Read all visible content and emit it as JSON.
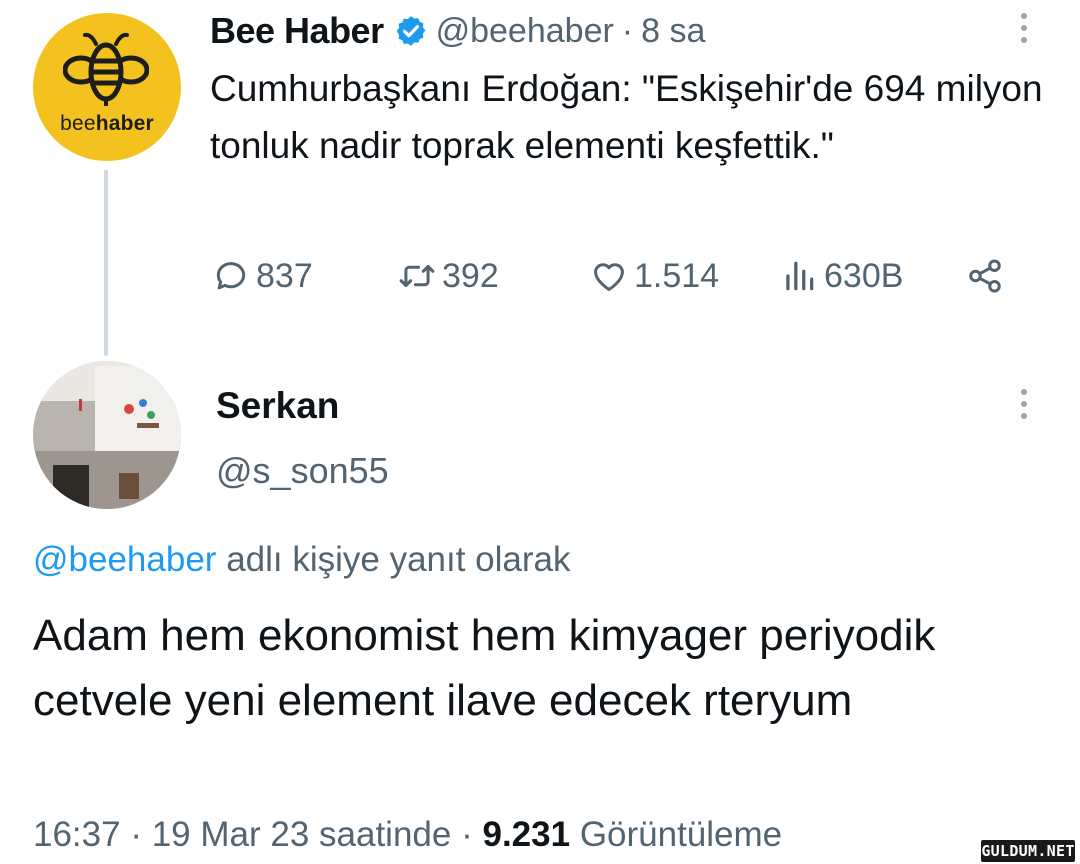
{
  "tweet": {
    "author": {
      "name": "Bee Haber",
      "handle": "@beehaber",
      "verified": true,
      "avatar_icon": "bee-logo-icon",
      "avatar_brand_color": "#f4c21e",
      "avatar_wordmark": {
        "prefix": "bee",
        "suffix": "haber"
      }
    },
    "separator": "·",
    "time": "8 sa",
    "text": "Cumhurbaşkanı Erdoğan: \"Eskişehir'de 694 milyon tonluk nadir toprak elementi keşfettik.\"",
    "actions": {
      "replies": "837",
      "retweets": "392",
      "likes": "1.514",
      "views": "630B"
    }
  },
  "reply": {
    "author": {
      "name": "Serkan",
      "handle": "@s_son55"
    },
    "replying_to_mention": "@beehaber",
    "replying_to_suffix": "adlı kişiye yanıt olarak",
    "text": "Adam hem ekonomist hem kimyager periyodik cetvele yeni element ilave edecek rteryum",
    "meta": {
      "time": "16:37",
      "sep1": "·",
      "date": "19 Mar 23 saatinde",
      "sep2": "·",
      "views_count": "9.231",
      "views_label": "Görüntüleme"
    }
  },
  "watermark": "GULDUM.NET",
  "colors": {
    "accent": "#1d9bf0",
    "secondary_text": "#536471",
    "primary_text": "#0f1419",
    "thread_line": "#cfd9de"
  }
}
